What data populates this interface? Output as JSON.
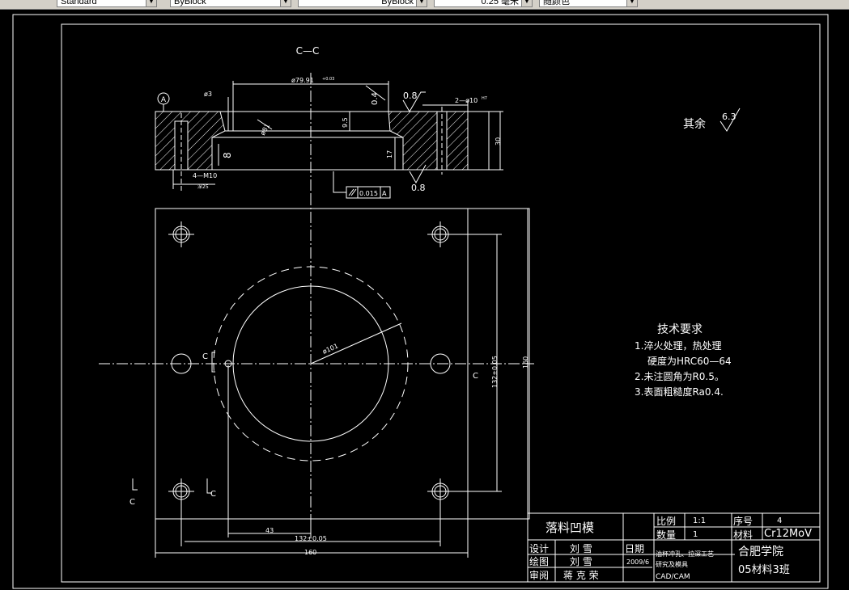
{
  "toolbar": {
    "text_style": "Standard",
    "layer": "ByBlock",
    "linetype": "ByBlock",
    "lineweight": "0.25 毫米",
    "plot_style": "随颜色"
  },
  "section_view": {
    "title": "C—C",
    "dim_bore": "ø79.91",
    "dim_bore_tol": "+0.03",
    "dim_small": "ø3",
    "datum": "A",
    "dim_chamfer": "0.4",
    "dim_depth": "9.5",
    "dim_relief": "ø81",
    "dim_height": "17",
    "dim_thickness": "30",
    "dim_relief_depth": "8",
    "dim_pins": "2—ø10",
    "dim_pins_tol": "H7",
    "thread_label": "4—M10",
    "thread_depth": "深25",
    "tolerance_symbol": "//",
    "tolerance_value": "0.015",
    "tolerance_datum": "A",
    "roughness_top": "0.8",
    "roughness_bottom": "0.8"
  },
  "roughness_other": {
    "label": "其余",
    "value": "6.3"
  },
  "plan_view": {
    "dim_circle": "ø101",
    "dim_vertical": "132±0.05",
    "dim_overall_v": "160",
    "dim_43": "43",
    "dim_horizontal": "132±0.05",
    "dim_overall_h": "160",
    "section_mark": "C"
  },
  "tech_requirements": {
    "title": "技术要求",
    "items": [
      "1.淬火处理，热处理",
      "硬度为HRC60—64",
      "2.未注圆角为R0.5。",
      "3.表面粗糙度Ra0.4."
    ]
  },
  "title_block": {
    "part_name": "落料凹模",
    "scale_label": "比例",
    "scale_value": "1:1",
    "serial_label": "序号",
    "serial_value": "4",
    "quantity_label": "数量",
    "quantity_value": "1",
    "material_label": "材料",
    "material_value": "Cr12MoV",
    "design_label": "设计",
    "design_name": "刘 雪",
    "drawing_label": "绘图",
    "drawing_name": "刘 雪",
    "review_label": "审阅",
    "review_name": "蒋 克 荣",
    "date_label": "日期",
    "date_value": "2009/6",
    "project_line1": "油杯冲孔、拉深工艺",
    "project_line2": "研究及模具",
    "project_line3": "CAD/CAM",
    "school": "合肥学院",
    "class": "05材料3班"
  },
  "colors": {
    "bg": "#000000",
    "line": "#ffffff",
    "toolbar": "#d4d0c8"
  }
}
